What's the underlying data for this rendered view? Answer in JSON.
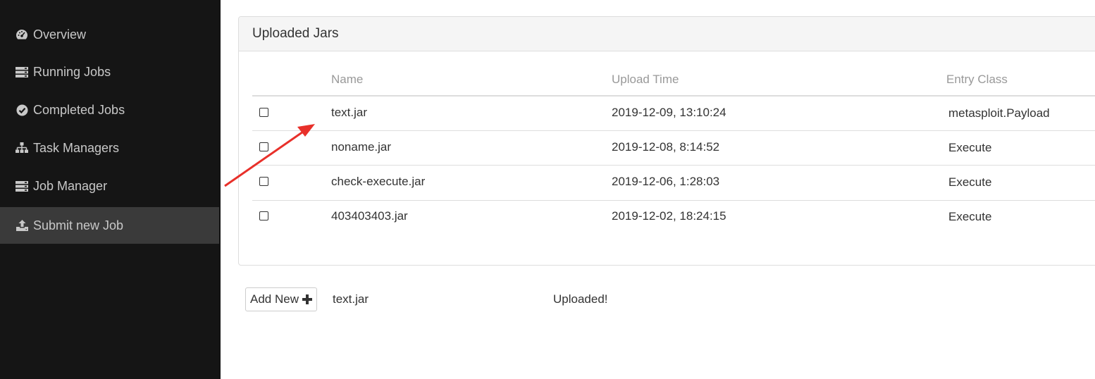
{
  "sidebar": {
    "items": [
      {
        "label": "Overview",
        "icon": "dashboard-icon"
      },
      {
        "label": "Running Jobs",
        "icon": "server-icon"
      },
      {
        "label": "Completed Jobs",
        "icon": "check-circle-icon"
      },
      {
        "label": "Task Managers",
        "icon": "sitemap-icon"
      },
      {
        "label": "Job Manager",
        "icon": "server-icon"
      },
      {
        "label": "Submit new Job",
        "icon": "upload-icon",
        "active": true
      }
    ]
  },
  "panel": {
    "title": "Uploaded Jars",
    "columns": [
      "Name",
      "Upload Time",
      "Entry Class"
    ],
    "rows": [
      {
        "name": "text.jar",
        "upload_time": "2019-12-09, 13:10:24",
        "entry_class": "metasploit.Payload",
        "checked": false
      },
      {
        "name": "noname.jar",
        "upload_time": "2019-12-08, 8:14:52",
        "entry_class": "Execute",
        "checked": false
      },
      {
        "name": "check-execute.jar",
        "upload_time": "2019-12-06, 1:28:03",
        "entry_class": "Execute",
        "checked": false
      },
      {
        "name": "403403403.jar",
        "upload_time": "2019-12-02, 18:24:15",
        "entry_class": "Execute",
        "checked": false
      }
    ]
  },
  "upload": {
    "add_new_label": "Add New",
    "file_name": "text.jar",
    "status": "Uploaded!"
  },
  "colors": {
    "sidebar_bg": "#151515",
    "sidebar_active": "#3a3a3a",
    "sidebar_text": "#c8c8c8",
    "annotation_arrow": "#e8302a"
  }
}
